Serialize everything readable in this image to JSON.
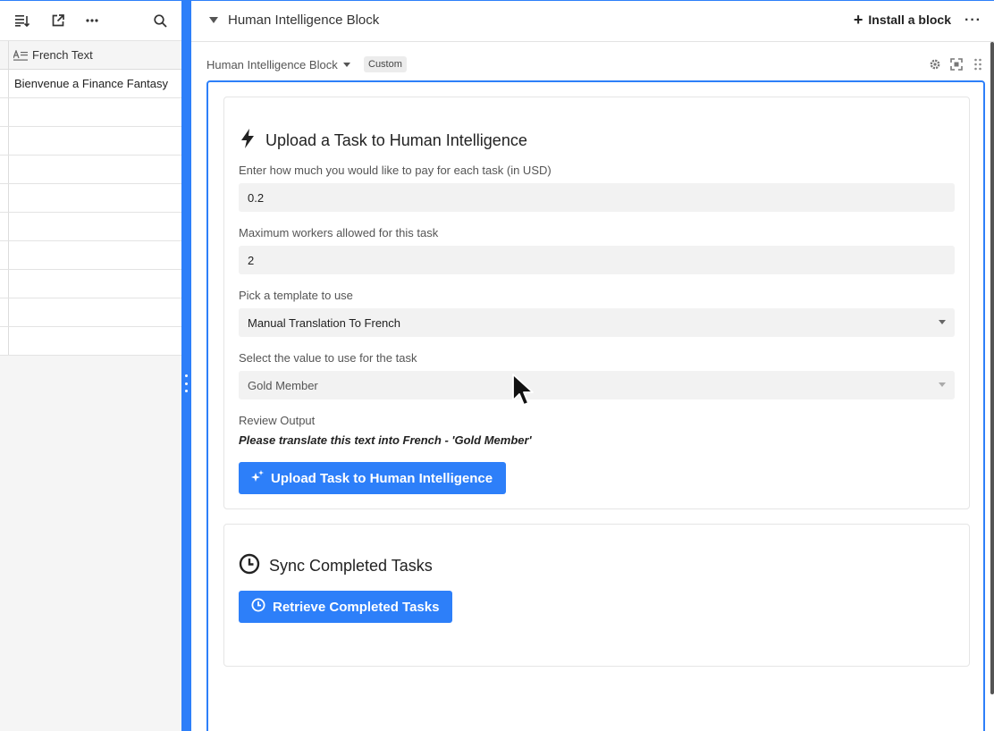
{
  "left_panel": {
    "toolbar_icons": [
      "sort-icon",
      "expand-record-icon",
      "more-icon",
      "search-icon"
    ],
    "column_header": "French Text",
    "rows": [
      "Bienvenue a Finance Fantasy",
      "",
      "",
      "",
      "",
      "",
      "",
      "",
      "",
      ""
    ]
  },
  "header": {
    "title": "Human Intelligence Block",
    "install_label": "Install a block",
    "more_label": "···"
  },
  "block_bar": {
    "name": "Human Intelligence Block",
    "badge": "Custom"
  },
  "upload_card": {
    "title": "Upload a Task to Human Intelligence",
    "pay_label": "Enter how much you would like to pay for each task (in USD)",
    "pay_value": "0.2",
    "workers_label": "Maximum workers allowed for this task",
    "workers_value": "2",
    "template_label": "Pick a template to use",
    "template_value": "Manual Translation To French",
    "value_label": "Select the value to use for the task",
    "value_value": "Gold Member",
    "review_label": "Review Output",
    "review_text": "Please translate this text into French - 'Gold Member'",
    "button_label": "Upload Task to Human Intelligence"
  },
  "sync_card": {
    "title": "Sync Completed Tasks",
    "button_label": "Retrieve Completed Tasks"
  },
  "colors": {
    "accent": "#2d7ff9",
    "field_bg": "#f2f2f2"
  }
}
